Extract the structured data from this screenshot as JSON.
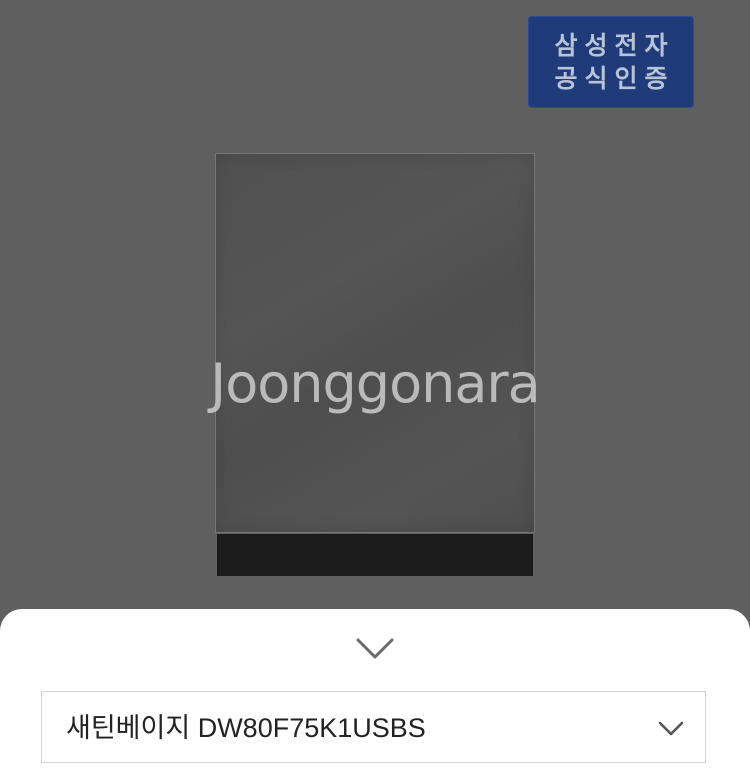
{
  "product_image": {
    "badge_line1": "삼성전자",
    "badge_line2": "공식인증",
    "watermark": "Joonggonara"
  },
  "sheet": {
    "collapse_icon": "chevron-down-icon",
    "selected_option": "새틴베이지 DW80F75K1USBS",
    "dropdown_icon": "chevron-down-icon"
  },
  "colors": {
    "badge_bg": "#1f3b7a",
    "overlay_bg": "#5f5f5f",
    "sheet_bg": "#ffffff"
  }
}
